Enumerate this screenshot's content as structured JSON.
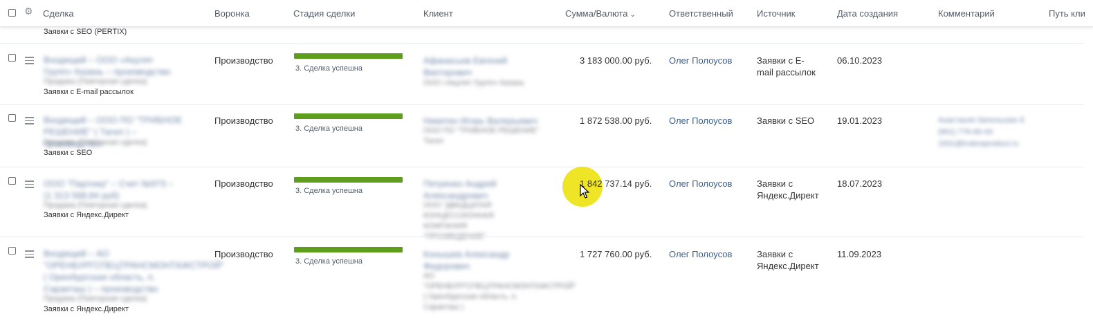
{
  "header": {
    "deal": "Сделка",
    "funnel": "Воронка",
    "stage": "Стадия сделки",
    "client": "Клиент",
    "amount": "Сумма/Валюта",
    "responsible": "Ответственный",
    "source": "Источник",
    "created": "Дата создания",
    "comment": "Комментарий",
    "path": "Путь кли"
  },
  "partial_row": {
    "source_label": "Заявки с SEO (PERTIX)"
  },
  "rows": [
    {
      "deal_title": "Входящий – ООО «Акулят Групп» Казань – производство",
      "deal_meta": "Продажа (Повторная сделка)",
      "deal_source": "Заявки с E-mail рассылок",
      "funnel": "Производство",
      "stage": "3. Сделка успешна",
      "client_name": "Афанасьев Евгений Викторович",
      "client_company": "ООО «Акулят Групп» Казань",
      "amount": "3 183 000.00 руб.",
      "responsible": "Олег Полоусов",
      "source": "Заявки с E-mail рассылок",
      "created": "06.10.2023",
      "comment": ""
    },
    {
      "deal_title": "Входящий – ООО ПО \"ТРИБНОЕ РЕШЕНИЕ\" ( Тагил ) – производство",
      "deal_meta": "Продажа (Повторная сделка)",
      "deal_source": "Заявки с SEO",
      "funnel": "Производство",
      "stage": "3. Сделка успешна",
      "client_name": "Никитин Игорь Валерьевич",
      "client_company": "ООО ПО \"ТРИБНОЕ РЕШЕНИЕ\"",
      "client_extra": "Тагил",
      "amount": "1 872 538.00 руб.",
      "responsible": "Олег Полоусов",
      "source": "Заявки с SEO",
      "created": "19.01.2023",
      "comment": "Анастасия Запольских 8 (901) 776-66-43 1931@trubnoproduct.ru"
    },
    {
      "deal_title": "ООО \"Партнер\" – Счет №973 – (1 313 568,84 руб)",
      "deal_meta": "Продажа (Повторная сделка)",
      "deal_source": "Заявки с Яндекс.Директ",
      "funnel": "Производство",
      "stage": "3. Сделка успешна",
      "client_name": "Петренко Андрей Александрович",
      "client_company": "ООО \"ДВАДЦАТАЯ КОНЦЕССИОННАЯ КОМПАНИЯ \"ПРОЗВЕДЕНИЕ\"",
      "amount": "1 842 737.14 руб.",
      "responsible": "Олег Полоусов",
      "source": "Заявки с Яндекс.Директ",
      "created": "18.07.2023",
      "comment": ""
    },
    {
      "deal_title": "Входящий – АО \"ОРЕНБУРГСПЕЦТРАНСМОНТАЖСТРОЙ\" ( Оренбургская область, п. Саракташ ) – производство",
      "deal_meta": "Продажа (Повторная сделка)",
      "deal_source": "Заявки с Яндекс.Директ",
      "funnel": "Производство",
      "stage": "3. Сделка успешна",
      "client_name": "Конышев Александр Федорович",
      "client_company": "АО \"ОРЕНБУРГСПЕЦТРАНСМОНТАЖСТРОЙ\" ( Оренбургская область, п. Саракташ )",
      "amount": "1 727 760.00 руб.",
      "responsible": "Олег Полоусов",
      "source": "Заявки с Яндекс.Директ",
      "created": "11.09.2023",
      "comment": ""
    }
  ],
  "colors": {
    "stage_bar": "#5e9e1c",
    "link": "#3a5f8c",
    "cursor_halo": "#ebe100"
  }
}
